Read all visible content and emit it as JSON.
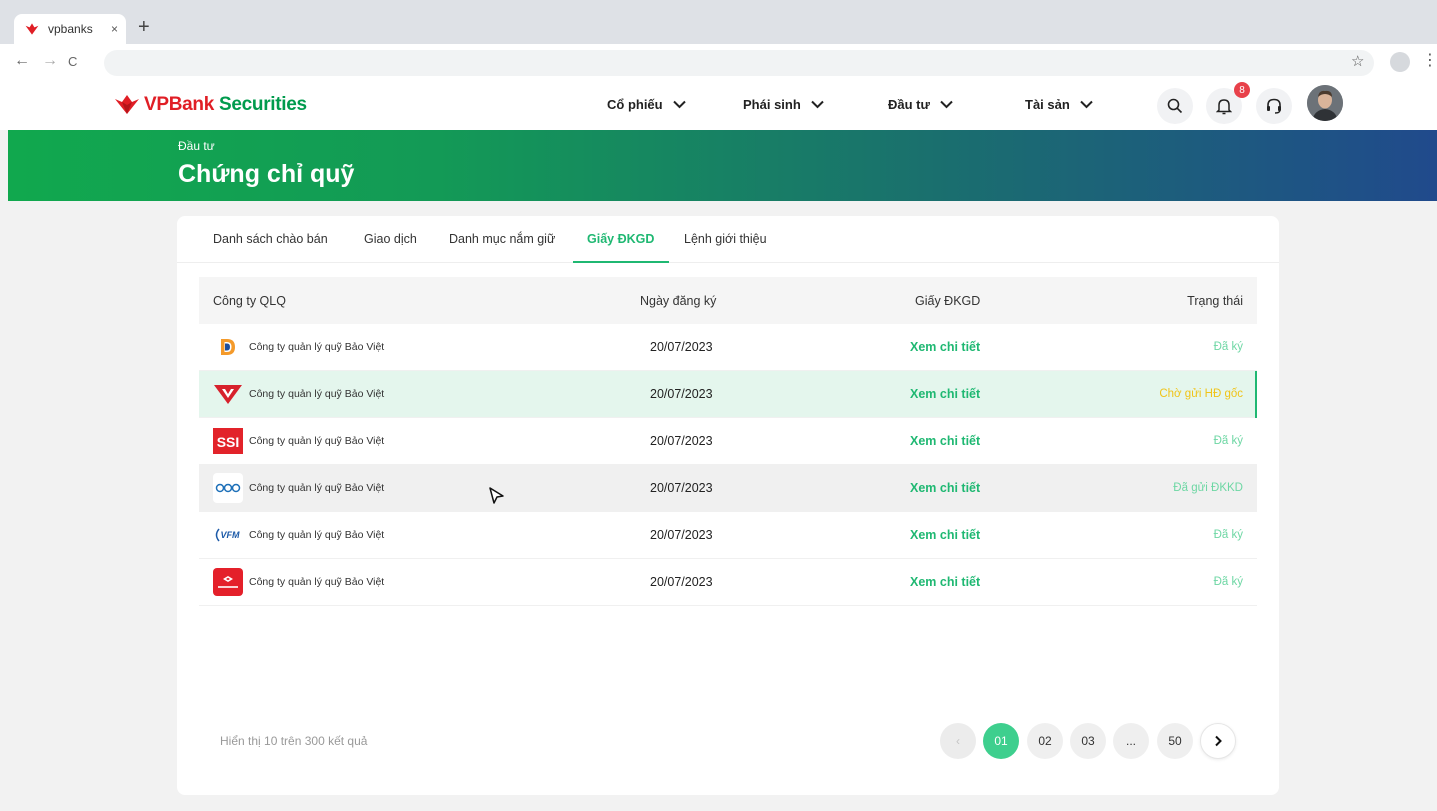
{
  "browser": {
    "tab_title": "vpbanks",
    "tab_close": "×",
    "new_tab": "+",
    "back": "←",
    "forward": "→",
    "reload": "C",
    "star": "☆",
    "menu": "⋮"
  },
  "header": {
    "logo_vp": "VPBank",
    "logo_rest": " Securities",
    "menu": [
      {
        "label": "Cổ phiếu"
      },
      {
        "label": "Phái sinh"
      },
      {
        "label": "Đầu tư"
      },
      {
        "label": "Tài sản"
      }
    ],
    "notification_count": "8"
  },
  "banner": {
    "breadcrumb": "Đầu tư",
    "title": "Chứng chỉ quỹ"
  },
  "tabs": [
    {
      "label": "Danh sách chào bán"
    },
    {
      "label": "Giao dịch"
    },
    {
      "label": "Danh mục nắm giữ"
    },
    {
      "label": "Giấy ĐKGD",
      "active": true
    },
    {
      "label": "Lệnh giới thiệu"
    }
  ],
  "table": {
    "columns": [
      "Công ty QLQ",
      "Ngày đăng ký",
      "Giấy ĐKGD",
      "Trạng thái"
    ],
    "rows": [
      {
        "logo": "D",
        "company": "Công ty quản lý quỹ Bảo Việt",
        "date": "20/07/2023",
        "doc": "Xem chi tiết",
        "status": "Đã ký",
        "status_color": "#6ed7a4"
      },
      {
        "logo": "VT",
        "company": "Công ty quản lý quỹ Bảo Việt",
        "date": "20/07/2023",
        "doc": "Xem chi tiết",
        "status": "Chờ gửi HĐ gốc",
        "status_color": "#f0c419"
      },
      {
        "logo": "SSI",
        "company": "Công ty quản lý quỹ Bảo Việt",
        "date": "20/07/2023",
        "doc": "Xem chi tiết",
        "status": "Đã ký",
        "status_color": "#6ed7a4"
      },
      {
        "logo": "OOO",
        "company": "Công ty quản lý quỹ Bảo Việt",
        "date": "20/07/2023",
        "doc": "Xem chi tiết",
        "status": "Đã gửi ĐKKD",
        "status_color": "#6ed7a4"
      },
      {
        "logo": "VFM",
        "company": "Công ty quản lý quỹ Bảo Việt",
        "date": "20/07/2023",
        "doc": "Xem chi tiết",
        "status": "Đã ký",
        "status_color": "#6ed7a4"
      },
      {
        "logo": "TECHCOMBANK",
        "company": "Công ty quản lý quỹ Bảo Việt",
        "date": "20/07/2023",
        "doc": "Xem chi tiết",
        "status": "Đã ký",
        "status_color": "#6ed7a4"
      }
    ]
  },
  "footer": {
    "summary": "Hiển thị 10 trên 300 kết quả",
    "pages": [
      "01",
      "02",
      "03",
      "...",
      "50"
    ],
    "prev": "‹",
    "next": "›"
  },
  "colors": {
    "brand_green": "#1fb872",
    "brand_red": "#e01e25",
    "status_green": "#6ed7a4",
    "status_yellow": "#f0c419"
  }
}
